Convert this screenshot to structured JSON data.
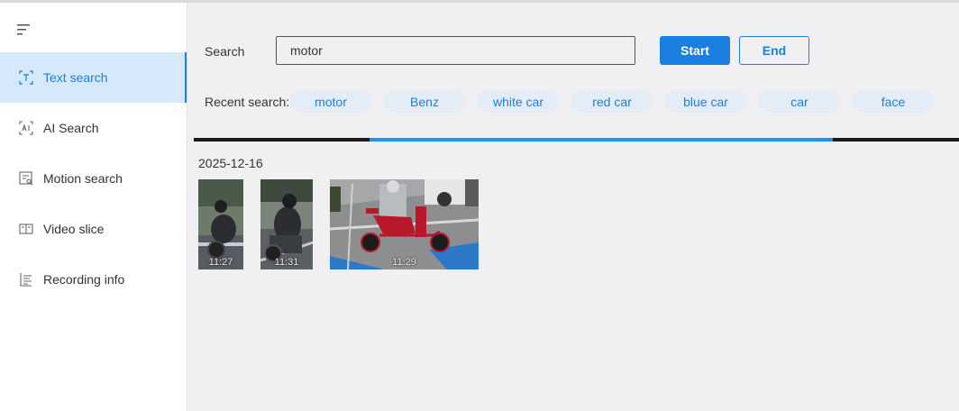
{
  "sidebar": {
    "items": [
      {
        "label": "Text search",
        "icon": "text-search-icon",
        "active": true
      },
      {
        "label": "AI Search",
        "icon": "ai-search-icon"
      },
      {
        "label": "Motion search",
        "icon": "motion-search-icon"
      },
      {
        "label": "Video slice",
        "icon": "video-slice-icon"
      },
      {
        "label": "Recording info",
        "icon": "recording-info-icon"
      }
    ]
  },
  "search": {
    "label": "Search",
    "value": "motor",
    "start_label": "Start",
    "end_label": "End"
  },
  "recent": {
    "label": "Recent search:",
    "items": [
      "motor",
      "Benz",
      "white car",
      "red car",
      "blue car",
      "car",
      "face"
    ]
  },
  "results": {
    "date": "2025-12-16",
    "items": [
      {
        "time": "11:27"
      },
      {
        "time": "11:31"
      },
      {
        "time": "11:29"
      }
    ]
  },
  "timeline": {
    "fill_start": 0.23,
    "fill_end": 0.835
  },
  "colors": {
    "accent": "#1b7fe0",
    "active_bg": "#d6e9fb",
    "chip_bg": "#e4edf6"
  }
}
